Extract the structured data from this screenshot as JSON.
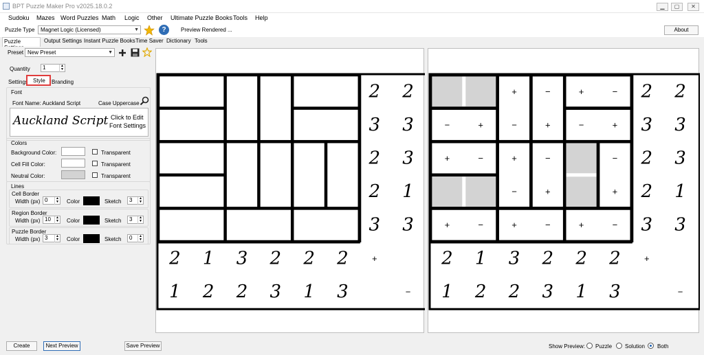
{
  "window": {
    "title": "BPT Puzzle Maker Pro v2025.18.0.2"
  },
  "menu": [
    "Sudoku",
    "Mazes",
    "Word Puzzles",
    "Math",
    "Logic",
    "Other",
    "Ultimate Puzzle Books",
    "Tools",
    "Help"
  ],
  "toolbar": {
    "puzzle_type_label": "Puzzle Type",
    "puzzle_type_value": "Magnet Logic (Licensed)",
    "status": "Preview Rendered ...",
    "about_label": "About",
    "info_label": "?"
  },
  "main_tabs": [
    "Puzzle Settings",
    "Output Settings",
    "Instant Puzzle Books",
    "Time Saver",
    "Dictionary",
    "Tools"
  ],
  "preset": {
    "label": "Preset",
    "value": "New Preset"
  },
  "quantity": {
    "label": "Quantity",
    "value": "1"
  },
  "sub_tabs": [
    "Settings",
    "Style",
    "Branding"
  ],
  "font": {
    "group_label": "Font",
    "name_label": "Font Name: Auckland Script",
    "case_label": "Case Uppercase",
    "preview_text": "Auckland Script",
    "click_line1": "Click to Edit",
    "click_line2": "Font Settings"
  },
  "colors": {
    "group_label": "Colors",
    "background_label": "Background Color:",
    "cell_fill_label": "Cell Fill Color:",
    "neutral_label": "Neutral Color:",
    "transparent_label": "Transparent",
    "background_color": "#ffffff",
    "cell_fill_color": "#ffffff",
    "neutral_color": "#d3d3d3"
  },
  "lines": {
    "group_label": "Lines",
    "width_label": "Width (px)",
    "color_label": "Color",
    "sketch_label": "Sketch",
    "cell_border": {
      "label": "Cell Border",
      "width": "0",
      "sketch": "3"
    },
    "region_border": {
      "label": "Region Border",
      "width": "10",
      "sketch": "3"
    },
    "puzzle_border": {
      "label": "Puzzle Border",
      "width": "3",
      "sketch": "0"
    }
  },
  "bottom": {
    "create": "Create",
    "next_preview": "Next Preview",
    "save_preview": "Save Preview",
    "show_preview_label": "Show Preview:",
    "options": [
      "Puzzle",
      "Solution",
      "Both"
    ],
    "selected": "Both"
  },
  "puzzle": {
    "row_plus_counts": [
      "2",
      "3",
      "2",
      "2",
      "3"
    ],
    "row_minus_counts": [
      "2",
      "3",
      "3",
      "1",
      "3"
    ],
    "col_plus_counts": [
      "2",
      "1",
      "3",
      "2",
      "2",
      "2"
    ],
    "col_minus_counts": [
      "1",
      "2",
      "2",
      "3",
      "1",
      "3"
    ],
    "plus_sign": "+",
    "minus_sign": "−",
    "solution_cells": [
      [
        "N",
        "N",
        "+",
        "−",
        "+",
        "−"
      ],
      [
        "−",
        "+",
        "−",
        "+",
        "−",
        "+"
      ],
      [
        "+",
        "−",
        "+",
        "−",
        "N",
        "−"
      ],
      [
        "N",
        "N",
        "−",
        "+",
        "N",
        "+"
      ],
      [
        "+",
        "−",
        "+",
        "−",
        "+",
        "−"
      ]
    ]
  }
}
